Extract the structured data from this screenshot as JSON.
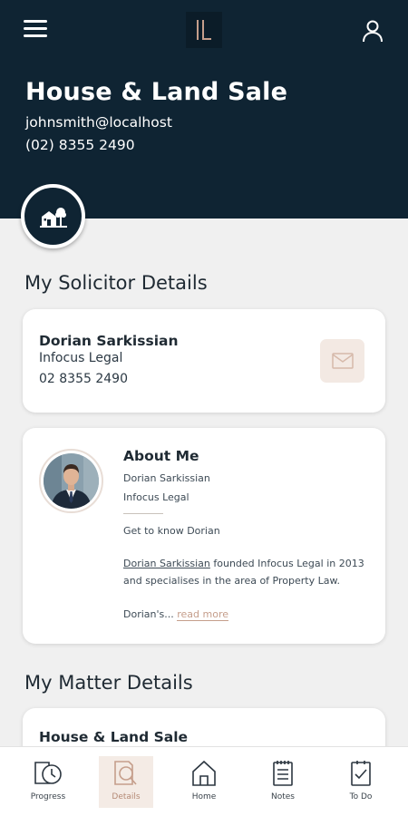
{
  "header": {
    "title": "House & Land Sale",
    "email": "johnsmith@localhost",
    "phone": "(02) 8355 2490"
  },
  "sections": {
    "solicitor_title": "My Solicitor Details",
    "matter_title": "My Matter Details"
  },
  "solicitor": {
    "name": "Dorian Sarkissian",
    "firm": "Infocus Legal",
    "phone": "02 8355 2490"
  },
  "about": {
    "title": "About Me",
    "name": "Dorian Sarkissian",
    "firm": "Infocus Legal",
    "intro": "Get to know Dorian",
    "bio_name": "Dorian Sarkissian",
    "bio_line1_rest": " founded Infocus Legal in 2013",
    "bio_line2": "and specialises in the area of Property Law.",
    "excerpt": "Dorian's...",
    "read_more": "read more"
  },
  "matter": {
    "name": "House & Land Sale"
  },
  "nav": {
    "active": "Details",
    "items": [
      {
        "label": "Progress",
        "icon": "clock-document-icon"
      },
      {
        "label": "Details",
        "icon": "magnifier-document-icon"
      },
      {
        "label": "Home",
        "icon": "home-icon"
      },
      {
        "label": "Notes",
        "icon": "notepad-icon"
      },
      {
        "label": "To Do",
        "icon": "checklist-icon"
      }
    ]
  },
  "colors": {
    "header_bg": "#0f2433",
    "accent": "#c59e8b",
    "accent_bg": "#f4ebe5",
    "page_bg": "#f0f0f0"
  }
}
